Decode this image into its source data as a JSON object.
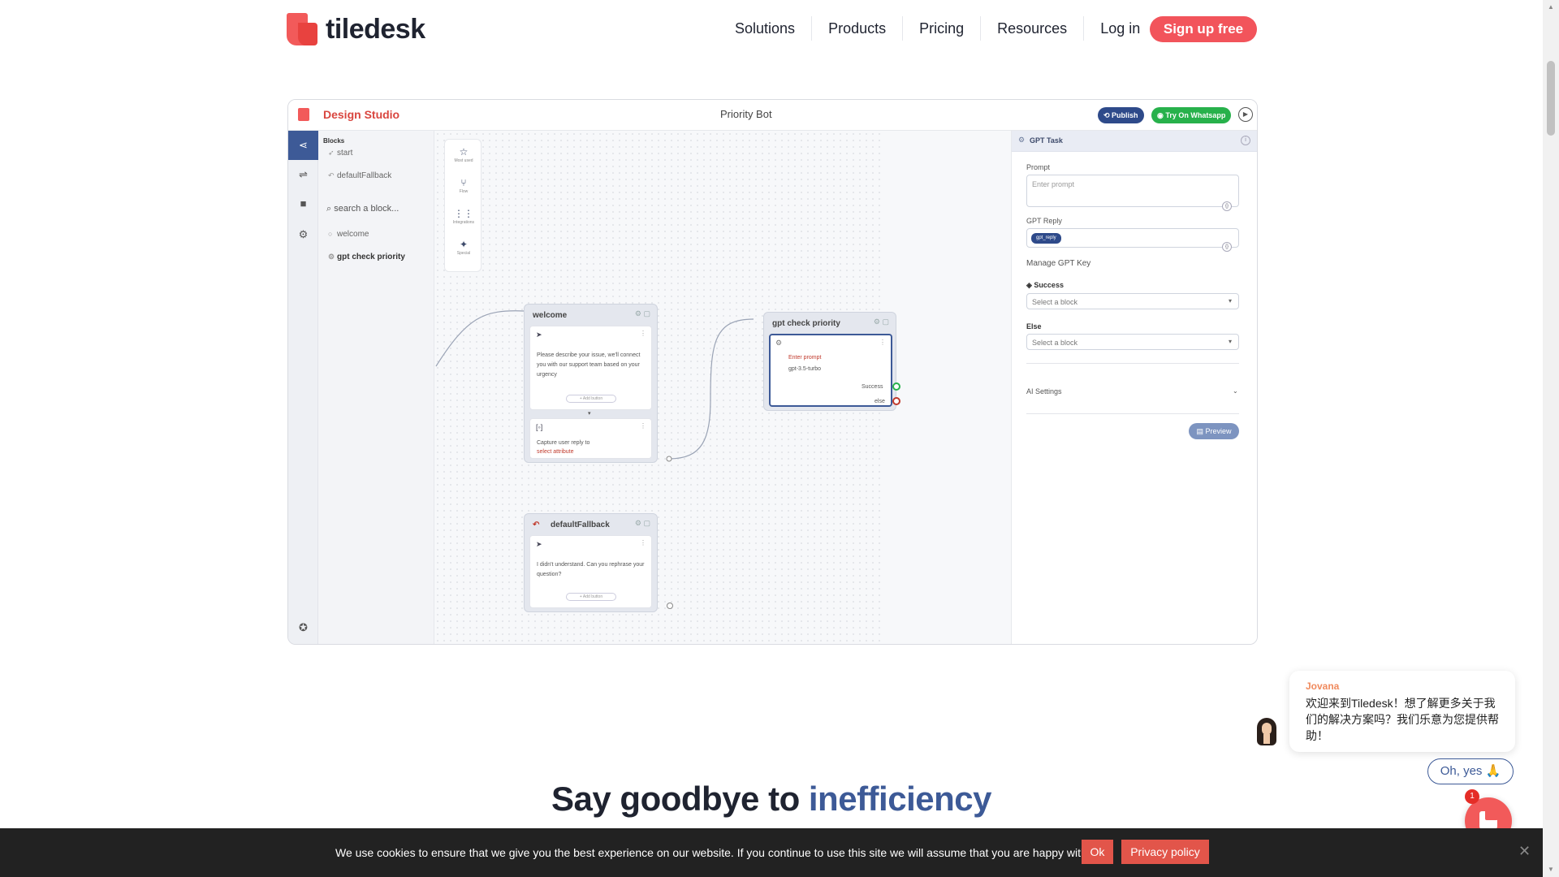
{
  "nav": {
    "logo": "tiledesk",
    "links": [
      "Solutions",
      "Products",
      "Pricing",
      "Resources",
      "Log in"
    ],
    "signup": "Sign up free"
  },
  "studio": {
    "title": "Design Studio",
    "bot_name": "Priority Bot",
    "publish": "Publish",
    "try_whatsapp": "Try On Whatsapp",
    "blocks": {
      "heading": "Blocks",
      "items": [
        "start",
        "defaultFallback",
        "welcome",
        "gpt check priority"
      ],
      "search_placeholder": "search a block..."
    },
    "palette": [
      "Most used",
      "Flow",
      "Integrations",
      "Special"
    ],
    "nodes": {
      "welcome": {
        "title": "welcome",
        "message": "Please describe your issue, we'll connect you with our support team based on your urgency",
        "add_button": "+ Add button",
        "capture": "Capture user reply to",
        "capture_attr": "select attribute"
      },
      "gpt": {
        "title": "gpt check priority",
        "prompt": "Enter prompt",
        "model": "gpt-3.5-turbo",
        "success": "Success",
        "else": "else"
      },
      "fallback": {
        "title": "defaultFallback",
        "message": "I didn't understand. Can you rephrase your question?",
        "add_button": "+ Add button"
      }
    },
    "panel": {
      "title": "GPT Task",
      "prompt_label": "Prompt",
      "prompt_placeholder": "Enter prompt",
      "reply_label": "GPT Reply",
      "reply_chip": "gpt_reply",
      "manage_key": "Manage GPT Key",
      "success_label": "Success",
      "success_select": "Select a block",
      "else_label": "Else",
      "else_select": "Select a block",
      "ai_settings": "AI Settings",
      "preview": "Preview"
    }
  },
  "headline": {
    "start": "Say goodbye to ",
    "accent": "inefficiency"
  },
  "chat": {
    "agent": "Jovana",
    "message": "欢迎来到Tiledesk！想了解更多关于我们的解决方案吗？我们乐意为您提供帮助！",
    "reply": "Oh, yes 🙏",
    "badge": "1"
  },
  "cookie": {
    "text": "We use cookies to ensure that we give you the best experience on our website. If you continue to use this site we will assume that you are happy with it.",
    "ok": "Ok",
    "privacy": "Privacy policy"
  },
  "colors": {
    "brand": "#f25a5a",
    "accent": "#3d5a97",
    "whatsapp": "#27b14b"
  }
}
